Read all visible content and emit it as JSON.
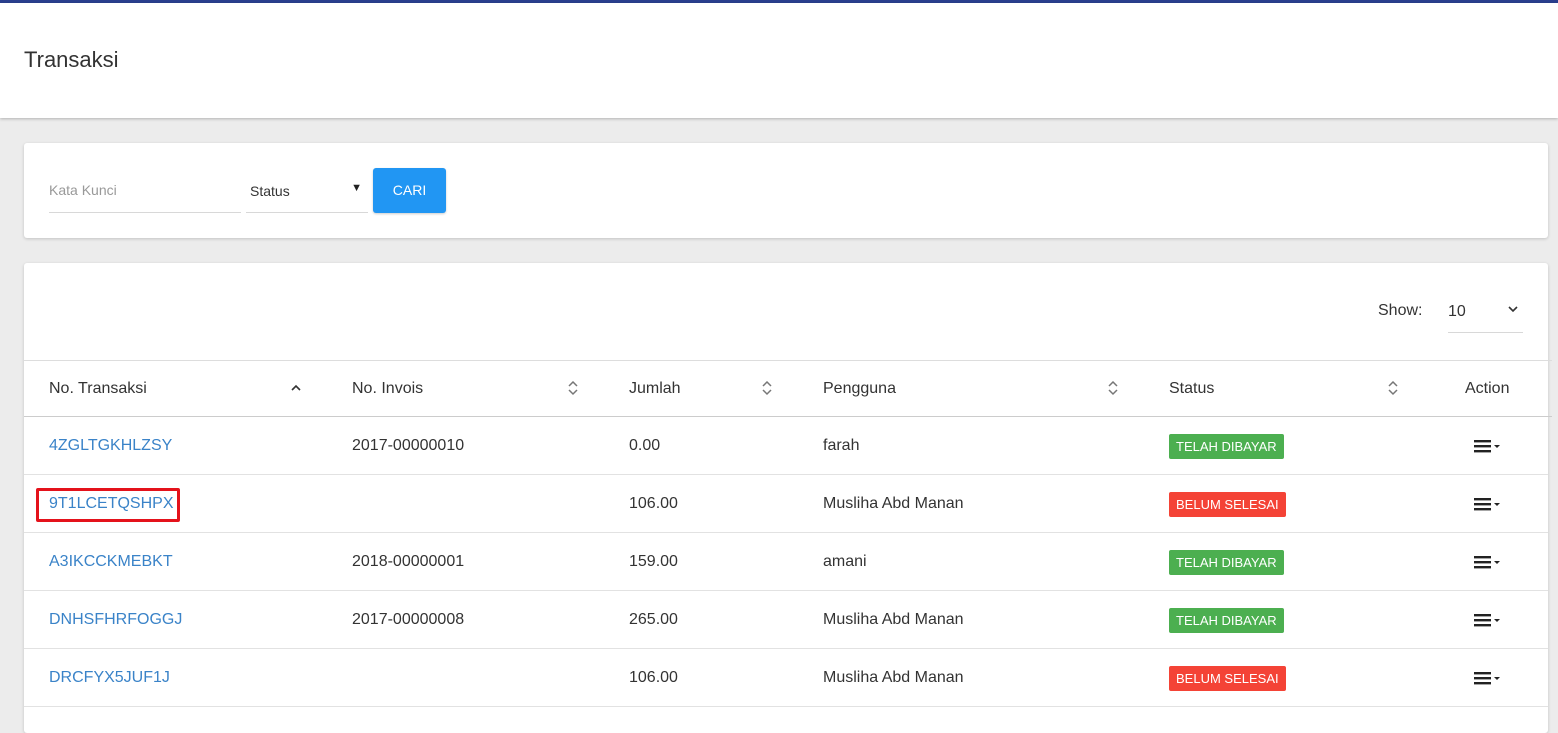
{
  "page": {
    "title": "Transaksi"
  },
  "search": {
    "keyword_placeholder": "Kata Kunci",
    "status_label": "Status",
    "button_label": "CARI"
  },
  "pagination": {
    "show_label": "Show:",
    "show_value": "10"
  },
  "table": {
    "headers": [
      "No. Transaksi",
      "No. Invois",
      "Jumlah",
      "Pengguna",
      "Status",
      "Action"
    ],
    "rows": [
      {
        "no_transaksi": "4ZGLTGKHLZSY",
        "no_invois": "2017-00000010",
        "jumlah": "0.00",
        "pengguna": "farah",
        "status": "TELAH DIBAYAR"
      },
      {
        "no_transaksi": "9T1LCETQSHPX",
        "no_invois": "",
        "jumlah": "106.00",
        "pengguna": "Musliha Abd Manan",
        "status": "BELUM SELESAI"
      },
      {
        "no_transaksi": "A3IKCCKMEBKT",
        "no_invois": "2018-00000001",
        "jumlah": "159.00",
        "pengguna": "amani",
        "status": "TELAH DIBAYAR"
      },
      {
        "no_transaksi": "DNHSFHRFOGGJ",
        "no_invois": "2017-00000008",
        "jumlah": "265.00",
        "pengguna": "Musliha Abd Manan",
        "status": "TELAH DIBAYAR"
      },
      {
        "no_transaksi": "DRCFYX5JUF1J",
        "no_invois": "",
        "jumlah": "106.00",
        "pengguna": "Musliha Abd Manan",
        "status": "BELUM SELESAI"
      }
    ]
  },
  "colors": {
    "link": "#3a83c8",
    "primary_button": "#2196f3",
    "status_paid": "#4caf50",
    "status_unpaid": "#f44336",
    "highlight": "#e4121b"
  },
  "icons": {
    "sort_active": "chevron-up-icon",
    "sort": "sort-icon",
    "action": "hamburger-menu-icon",
    "select": "caret-down-icon"
  }
}
